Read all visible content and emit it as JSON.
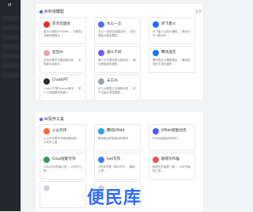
{
  "sidebar": {
    "title": "M"
  },
  "ai_models": {
    "title": "AI对话模型",
    "more": "更多",
    "cards": [
      {
        "name": "华为云盘古",
        "desc": "盘古大模型(Huawei ... 大模型/全面地覆盖大 ..."
      },
      {
        "name": "文心一言",
        "desc": "文心一言是百度推出的 ... 知识增强大语言模型 ..."
      },
      {
        "name": "讯飞星火",
        "desc": "讯飞星火认知大模型 ... 是科大讯飞推出的 ..."
      },
      {
        "name": "豆包AI",
        "desc": "豆包AI是字节跳动推出的 ... AI智能对话助手 ..."
      },
      {
        "name": "通义千问",
        "desc": "通义千问是阿里云推出的 ... 超大规模语言模型 ..."
      },
      {
        "name": "腾讯混元",
        "desc": "腾讯混元大模型是由 ... 腾讯研发的大语言模型 ..."
      },
      {
        "name": "ChatGPT",
        "desc": "ChatGPT是OpenAI推出 ... 的人工智能聊天机器人 ..."
      },
      {
        "name": "天工AI",
        "desc": "天工AI是昆仑万维推出的 ... 双千亿级大语言模型 ..."
      }
    ]
  },
  "ai_writing": {
    "title": "AI写作工具",
    "cards": [
      {
        "name": "火山写作",
        "desc": "火山写作是字节跳动推出的 ... AI写作工具 ..."
      },
      {
        "name": "腾讯Effidit",
        "desc": "腾讯推出的智能创作助手 ..."
      },
      {
        "name": "Effidit智能创作",
        "desc": "Effidit智能创作助手 ..."
      },
      {
        "name": "Giiso智能写作",
        "desc": "Giiso写作机器人是 ... AI写作工具 ..."
      },
      {
        "name": "Get写作",
        "desc": "Get写作是一款AI写作 ... 辅助工具 ..."
      },
      {
        "name": "秘塔写作猫",
        "desc": "秘塔写作猫是一款 ... AI写作辅助工具 ..."
      },
      {
        "name": "",
        "desc": ""
      },
      {
        "name": "",
        "desc": ""
      }
    ]
  },
  "watermark": "便民库",
  "colors": {
    "sidebar": "#24272e",
    "accent": "#2f6bff"
  }
}
